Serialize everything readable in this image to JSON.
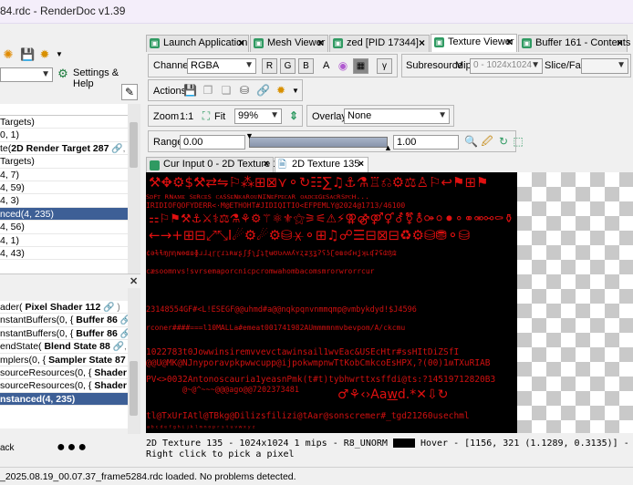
{
  "window": {
    "title": "84.rdc - RenderDoc v1.39"
  },
  "left_toolbar": {
    "settings_label": "Settings & Help"
  },
  "event_tree": {
    "rows": [
      {
        "text": " Targets)",
        "bold": "",
        "suffix": ""
      },
      {
        "text": "0, 1)",
        "bold": "",
        "suffix": ""
      },
      {
        "text": "te(",
        "bold": "2D Render Target 287",
        "suffix": " 🔗, 2D"
      },
      {
        "text": "Targets)",
        "bold": "",
        "suffix": ""
      },
      {
        "text": "4, 7)",
        "bold": "",
        "suffix": ""
      },
      {
        "text": "4, 59)",
        "bold": "",
        "suffix": ""
      },
      {
        "text": "4, 3)",
        "bold": "",
        "suffix": ""
      },
      {
        "text": "nced(4, 235)",
        "bold": "",
        "suffix": "",
        "selected": true
      },
      {
        "text": "4, 56)",
        "bold": "",
        "suffix": ""
      },
      {
        "text": "4, 1)",
        "bold": "",
        "suffix": ""
      },
      {
        "text": "4, 43)",
        "bold": "",
        "suffix": ""
      }
    ]
  },
  "api_tree": {
    "rows": [
      {
        "text": "ader( ",
        "bold": "Pixel Shader 112",
        "suffix": " 🔗 )"
      },
      {
        "text": "nstantBuffers(0, { ",
        "bold": "Buffer 86",
        "suffix": " 🔗 })"
      },
      {
        "text": "nstantBuffers(0, { ",
        "bold": "Buffer 86",
        "suffix": " 🔗 })"
      },
      {
        "text": "endState( ",
        "bold": "Blend State 88",
        "suffix": " 🔗, {})"
      },
      {
        "text": "mplers(0, { ",
        "bold": "Sampler State 87",
        "suffix": " 🔗"
      },
      {
        "text": "sourceResources(0, { ",
        "bold": "Shader Resour",
        "suffix": ""
      },
      {
        "text": "sourceResources(0, { ",
        "bold": "Shader Resour",
        "suffix": ""
      },
      {
        "text": "nstanced(4, 235)",
        "bold": "",
        "suffix": "",
        "selected": true
      }
    ],
    "stack_label": "ack"
  },
  "tabs": [
    {
      "label": "Launch Application"
    },
    {
      "label": "Mesh Viewer"
    },
    {
      "label": "zed [PID 17344]"
    },
    {
      "label": "Texture Viewer",
      "active": true
    },
    {
      "label": "Buffer 161 - Contents"
    }
  ],
  "texture_viewer": {
    "channels_label": "Channels",
    "channels_value": "RGBA",
    "channel_buttons": [
      "R",
      "G",
      "B"
    ],
    "alpha_label": "A",
    "gamma_label": "γ",
    "subresource_label": "Subresource",
    "mip_label": "Mip",
    "mip_value": "0 - 1024x1024",
    "slice_label": "Slice/Face",
    "actions_label": "Actions",
    "zoom_label": "Zoom",
    "zoom_1to1": "1:1",
    "fit_label": "Fit",
    "zoom_value": "99%",
    "overlay_label": "Overlay",
    "overlay_value": "None",
    "range_label": "Range",
    "range_min": "0.00",
    "range_max": "1.00"
  },
  "viewer_tabs": [
    {
      "label": "Cur Input 0 - 2D Texture 135"
    },
    {
      "label": "2D Texture 135",
      "active": true
    }
  ],
  "texture_text": {
    "r1": "ꜱᴅꜰᴛ ʀɴᴀᴍᴇ ꜱᴇʀᴄᴇꜱ ᴄᴀꜱꜱᴇɴᴋᴀʀᴏᴜɴɪɴᴇꜰᴘᴇᴄᴀʀ ᴏᴀᴅᴄᴇɢᴇꜱᴀᴄʀꜱᴘᴄʜ...",
    "r2": "IRIDIOFQOFYDERR<·M@ETHOHT#JIDIQITIO<EFPEMLY@2024@1713/46100",
    "r3": "¢əɫɬɱɲɳɴɵɶɷɸɹɺɻɼɽɾɿʀʁʂʃʄʅʆʇʈʉʊʋʌʍʎʏʐʑʒʓʔʕʖʗʘʙʚʛʜʝʞʟʠʡʢʣʤʥ",
    "r4": "cæsoomnvs!svrsemaporcnicpcromwahombacomsmrorwrorrcur",
    "r5": "23148554GF#<L!ESEGF@@uhmd#a@@nqkpqnvnmmqmp@vmbykdyd!$J4596",
    "r6": "rconer####===l10MALLa#emeat001741982AUmmmmnmvbevpom/A/ckcmu",
    "r7": "1022783t0Jowwinsiremvvevctawinsail1wvEac&USEcHtr#ssHItDiZSfI",
    "r8": "@@U@MK@NJnyporavpkpwwcupp@ijpokwmpnwTtKobCmkcoEsHPX,?(00)1ʍTXuRIAB",
    "r9": "PV<>0032Antonoscauria1yeasnPmk(t#t)tybhwrttxsffdi@ts:?14519712820B3",
    "r10": "@~@^~~~@@@ago@@7202373481",
    "r11": "tl@TxUrIAtl@ТBkg@Dilizsfilizi@tAar@sonscremer#_tgd21260usechml",
    "r12": "ᵃᵇᶜᵈᵉᶠᵍʰⁱʲᵏˡᵐⁿᵒᵖʳˢᵗᵘᵛʷˣʸᶻ"
  },
  "tex_status": {
    "line1_a": "2D Texture 135 - 1024x1024 1 mips - R8_UNORM",
    "line1_b": "Hover - [1156,  321 (1.1289, 0.3135)] -",
    "line2": "Right click to pick a pixel"
  },
  "statusbar": {
    "text": "_2025.08.19_00.07.37_frame5284.rdc loaded. No problems detected."
  }
}
